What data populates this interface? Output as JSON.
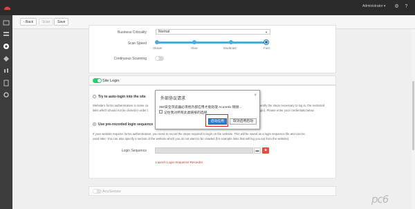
{
  "topbar": {
    "user": "Administrator ▾",
    "icons": [
      "gear-icon",
      "help-icon"
    ]
  },
  "sidebar": {
    "items": [
      "dashboard-icon",
      "targets-icon",
      "scans-icon",
      "vulnerabilities-icon",
      "reports-icon",
      "settings-icon",
      "document-icon"
    ]
  },
  "toolbar": {
    "back_label": "‹ Back",
    "scan_label": "Scan",
    "save_label": "Save"
  },
  "settings": {
    "criticality_label": "Business Criticality",
    "criticality_value": "Normal",
    "scan_speed_label": "Scan Speed",
    "speed_options": [
      "Slower",
      "Slow",
      "Moderate",
      "Fast"
    ],
    "speed_selected": "Fast",
    "continuous_label": "Continuous Scanning"
  },
  "site_login": {
    "title": "Site Login",
    "option_auto": "Try to auto-login into the site",
    "auto_desc_1": "Website's forms authentication in some ca",
    "auto_desc_1b": "entify the steps necessary to log in, the restricted",
    "auto_desc_2": "links which should not be clicked in order t",
    "auto_desc_2b": "gin). Please enter your credentials below.",
    "option_sequence": "Use pre-recorded login sequence",
    "seq_desc_1": "If your website requires forms authentication, you need to record the steps required to login on the website. This will be saved as a login sequence file and can be",
    "seq_desc_2": "used later. You can also specify a section of the website which you do not want to be crawled (for example links that will log you out from the website).",
    "seq_label": "Login Sequence",
    "launch_link": "Launch Login Sequence Recorder"
  },
  "acusensor": {
    "title": "AcuSensor"
  },
  "dialog": {
    "title": "外部协议请求",
    "close": "×",
    "message": "360安全浏览器必须给外部应用才能处理 Acunetix 链接...",
    "checkbox_label": "记住我对所有此类链接的选择",
    "primary_button": "启动应用",
    "cancel_button": "取消启用启动"
  },
  "watermark": "pc6",
  "colors": {
    "accent": "#2a6fb0",
    "toggle_on": "#2ecc71",
    "danger": "#e74c3c"
  }
}
